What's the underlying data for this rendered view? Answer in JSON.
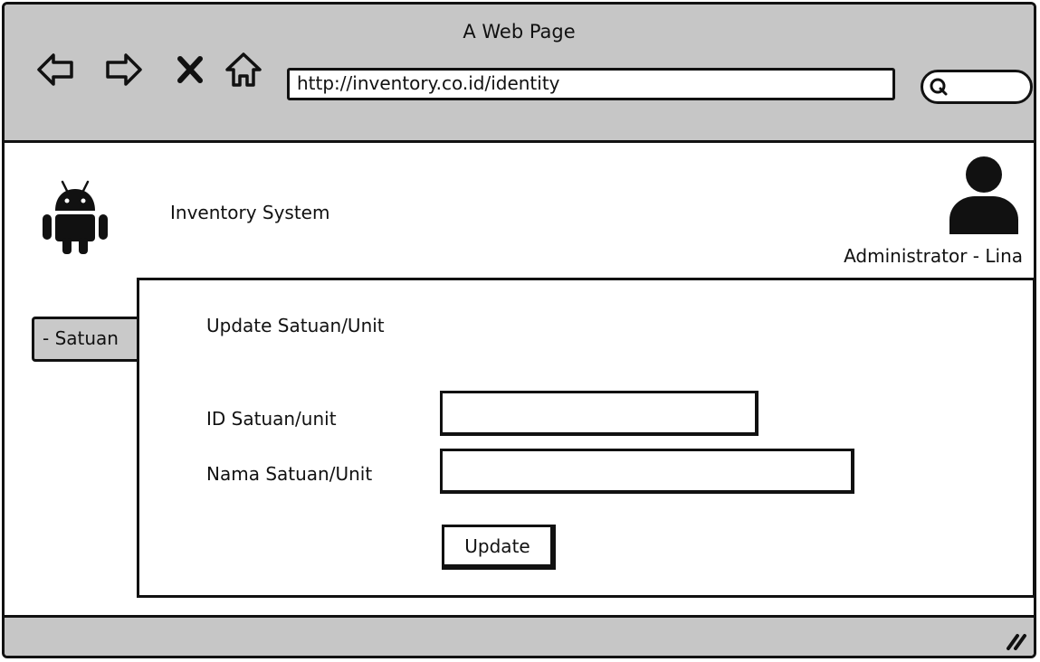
{
  "window": {
    "title": "A Web Page"
  },
  "browser": {
    "url": "http://inventory.co.id/identity",
    "icons": {
      "back": "back-arrow-icon",
      "forward": "forward-arrow-icon",
      "stop": "close-icon",
      "home": "home-icon",
      "search": "search-icon"
    }
  },
  "header": {
    "app_title": "Inventory System",
    "logo_icon": "android-icon",
    "avatar_icon": "user-icon",
    "user_label": "Administrator - Lina"
  },
  "sidebar": {
    "items": [
      {
        "label": "- Satuan"
      }
    ]
  },
  "form": {
    "title": "Update Satuan/Unit",
    "fields": [
      {
        "label": "ID Satuan/unit",
        "value": ""
      },
      {
        "label": "Nama Satuan/Unit",
        "value": ""
      }
    ],
    "submit_label": "Update"
  },
  "colors": {
    "chrome": "#c6c6c6",
    "outline": "#111111",
    "tab": "#c9c9c9"
  }
}
